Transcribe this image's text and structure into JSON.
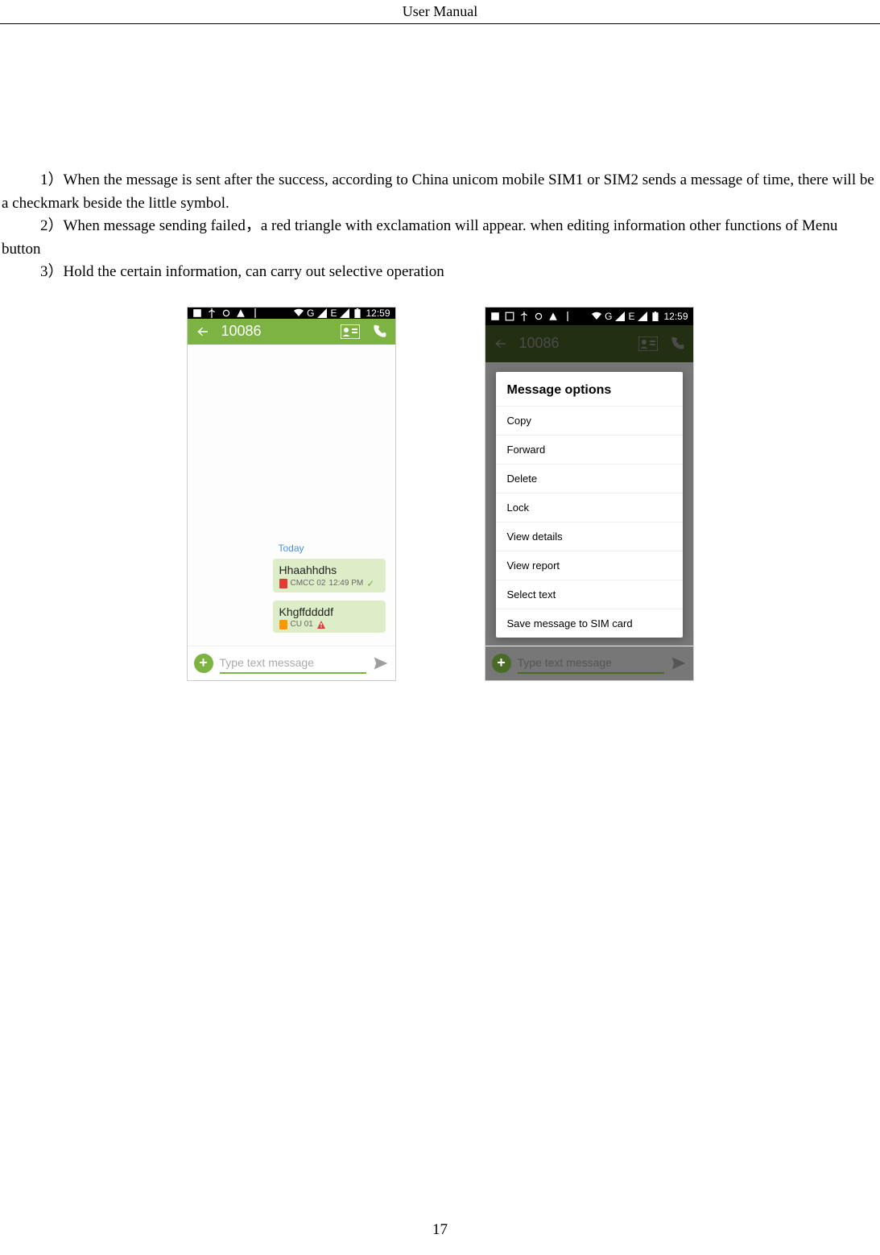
{
  "header": {
    "title": "User    Manual"
  },
  "paragraphs": {
    "p1": "1）When the message is sent after the success, according to China unicom mobile SIM1 or SIM2 sends a message of time, there will be a checkmark beside the little symbol.",
    "p2": "2）When message sending failed，a red triangle with exclamation will appear. when editing information other functions of Menu button",
    "p3": "3）Hold the certain information, can carry out selective operation"
  },
  "phone_common": {
    "status_time": "12:59",
    "status_g": "G",
    "status_e": "E",
    "action_title": "10086",
    "input_placeholder": "Type text message",
    "today_label": "Today"
  },
  "phone1": {
    "bubble1": {
      "text": "Hhaahhdhs",
      "carrier": "CMCC 02",
      "time": "12:49 PM"
    },
    "bubble2": {
      "text": "Khgffddddf",
      "carrier": "CU 01"
    }
  },
  "dialog": {
    "title": "Message options",
    "items": [
      "Copy",
      "Forward",
      "Delete",
      "Lock",
      "View details",
      "View report",
      "Select text",
      "Save message to SIM card"
    ]
  },
  "footer": {
    "page_number": "17"
  }
}
